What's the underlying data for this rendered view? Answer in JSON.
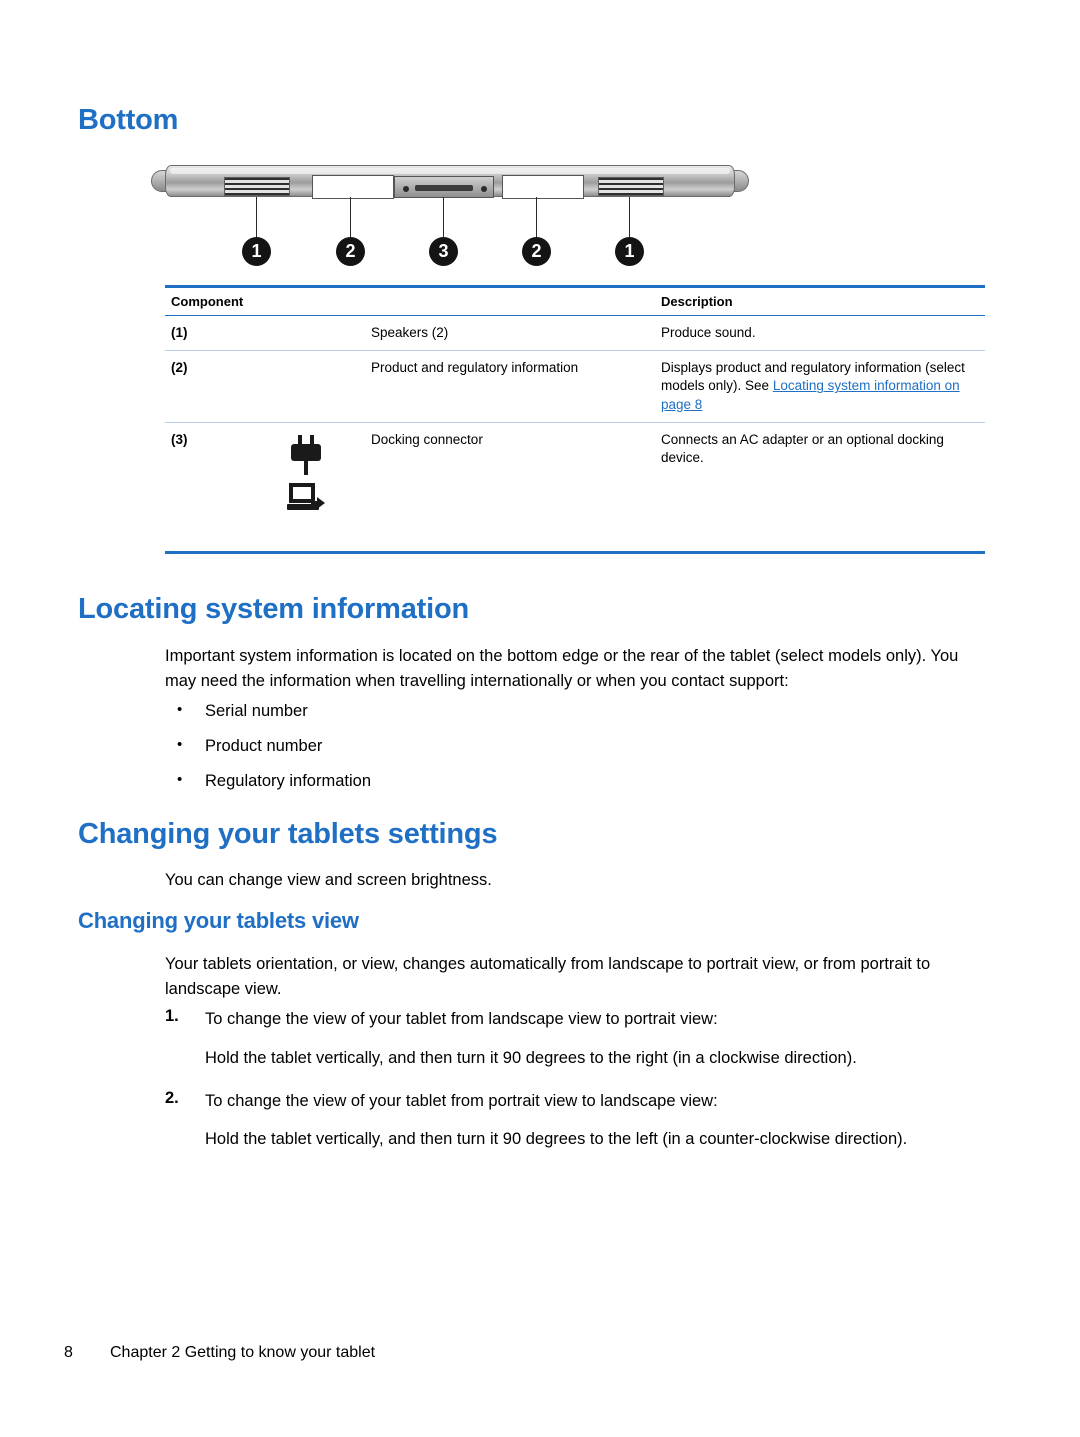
{
  "headings": {
    "bottom": "Bottom",
    "locating": "Locating system information",
    "changing_settings": "Changing your tablets settings",
    "changing_view": "Changing your tablets view"
  },
  "figure": {
    "callouts": [
      "1",
      "2",
      "3",
      "2",
      "1"
    ]
  },
  "components_table": {
    "headers": {
      "component": "Component",
      "description": "Description"
    },
    "rows": [
      {
        "num": "(1)",
        "name": "Speakers (2)",
        "description": "Produce sound."
      },
      {
        "num": "(2)",
        "name": "Product and regulatory information",
        "description_part1": "Displays product and regulatory information (select models only). See ",
        "description_link": "Locating system information on page",
        "description_page": " 8"
      },
      {
        "num": "(3)",
        "name": "Docking connector",
        "description": "Connects an AC adapter or an optional docking device.",
        "icons": [
          "power-plug-icon",
          "docking-station-icon"
        ]
      }
    ]
  },
  "locating_section": {
    "paragraph": "Important system information is located on the bottom edge or the rear of the tablet (select models only). You may need the information when travelling internationally or when you contact support:",
    "bullets": [
      "Serial number",
      "Product number",
      "Regulatory information"
    ]
  },
  "settings_section": {
    "paragraph": "You can change view and screen brightness."
  },
  "view_section": {
    "paragraph": "Your tablets orientation, or view, changes automatically from landscape to portrait view, or from portrait to landscape view.",
    "steps": [
      {
        "marker": "1.",
        "text": "To change the view of your tablet from landscape view to portrait view:",
        "detail": "Hold the tablet vertically, and then turn it 90 degrees to the right (in a clockwise direction)."
      },
      {
        "marker": "2.",
        "text": "To change the view of your tablet from portrait view to landscape view:",
        "detail": "Hold the tablet vertically, and then turn it 90 degrees to the left (in a counter-clockwise direction)."
      }
    ]
  },
  "footer": {
    "page_number": "8",
    "chapter": "Chapter 2  Getting to know your tablet"
  },
  "colors": {
    "heading_blue": "#1f6fc4",
    "link_blue": "#1f6fc4",
    "rule_blue": "#1f6fc4"
  }
}
